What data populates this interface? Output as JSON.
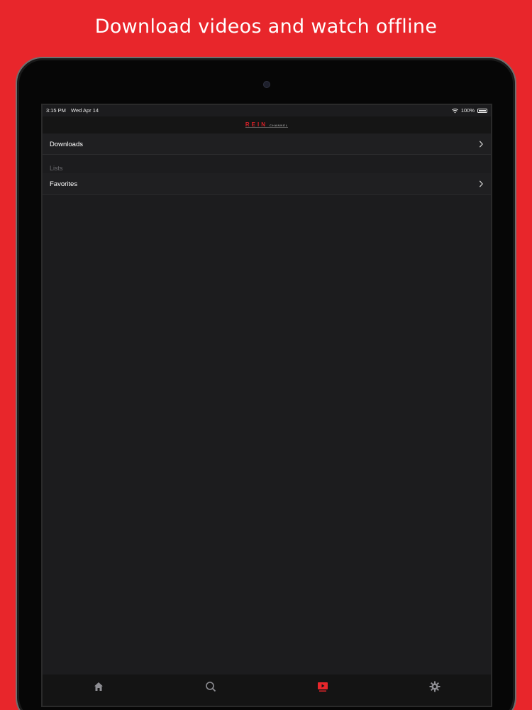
{
  "headline": "Download videos and watch offline",
  "status": {
    "time": "3:15 PM",
    "date": "Wed Apr 14",
    "battery": "100%"
  },
  "header": {
    "logo_main": "REIN",
    "logo_sub": "CHANNEL"
  },
  "rows": {
    "downloads": "Downloads",
    "section_lists": "Lists",
    "favorites": "Favorites"
  },
  "tabs": [
    {
      "icon": "home-icon",
      "active": false
    },
    {
      "icon": "search-icon",
      "active": false
    },
    {
      "icon": "video-library-icon",
      "active": true
    },
    {
      "icon": "settings-icon",
      "active": false
    }
  ],
  "colors": {
    "accent": "#e8262b",
    "screen_bg": "#1c1c1e",
    "tab_active": "#e8262b",
    "tab_inactive": "#8e8e93"
  }
}
